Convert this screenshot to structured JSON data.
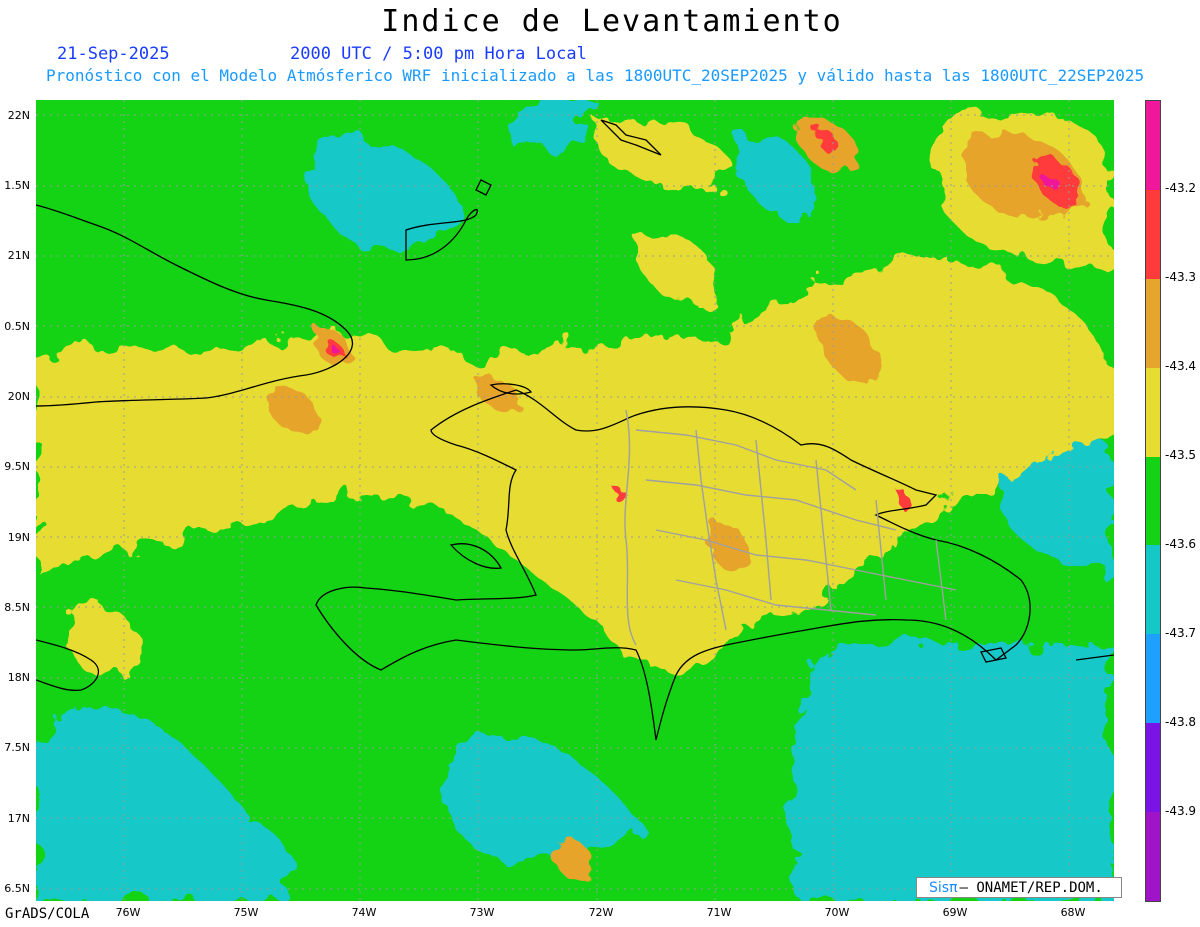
{
  "title": "Indice de Levantamiento",
  "date": "21-Sep-2025",
  "time": "2000 UTC / 5:00 pm Hora Local",
  "subtitle": "Pronóstico con el Modelo Atmósferico WRF inicializado a las 1800UTC_20SEP2025 y válido hasta las  1800UTC_22SEP2025",
  "lat_labels": [
    "22N",
    "1.5N",
    "21N",
    "0.5N",
    "20N",
    "9.5N",
    "19N",
    "8.5N",
    "18N",
    "7.5N",
    "17N",
    "6.5N"
  ],
  "lon_labels": [
    "76W",
    "75W",
    "74W",
    "73W",
    "72W",
    "71W",
    "70W",
    "69W",
    "68W"
  ],
  "colorbar": {
    "labels": [
      "-43.2",
      "-43.3",
      "-43.4",
      "-43.5",
      "-43.6",
      "-43.7",
      "-43.8",
      "-43.9"
    ],
    "colors": [
      "#f0189a",
      "#ff3a3a",
      "#e6a52c",
      "#e6dc32",
      "#14d214",
      "#14c8c8",
      "#1ea0ff",
      "#7a14e6",
      "#a014c8"
    ]
  },
  "credit_left": "GrADS/COLA",
  "logo": {
    "sis": "Sisπ",
    "text": "– ONAMET/REP.DOM."
  },
  "colors": {
    "green": "#14d214",
    "cyan": "#14c8c8",
    "yellow": "#e6dc32",
    "orange": "#e6a52c",
    "red": "#ff3a3a",
    "magenta": "#f0189a"
  }
}
